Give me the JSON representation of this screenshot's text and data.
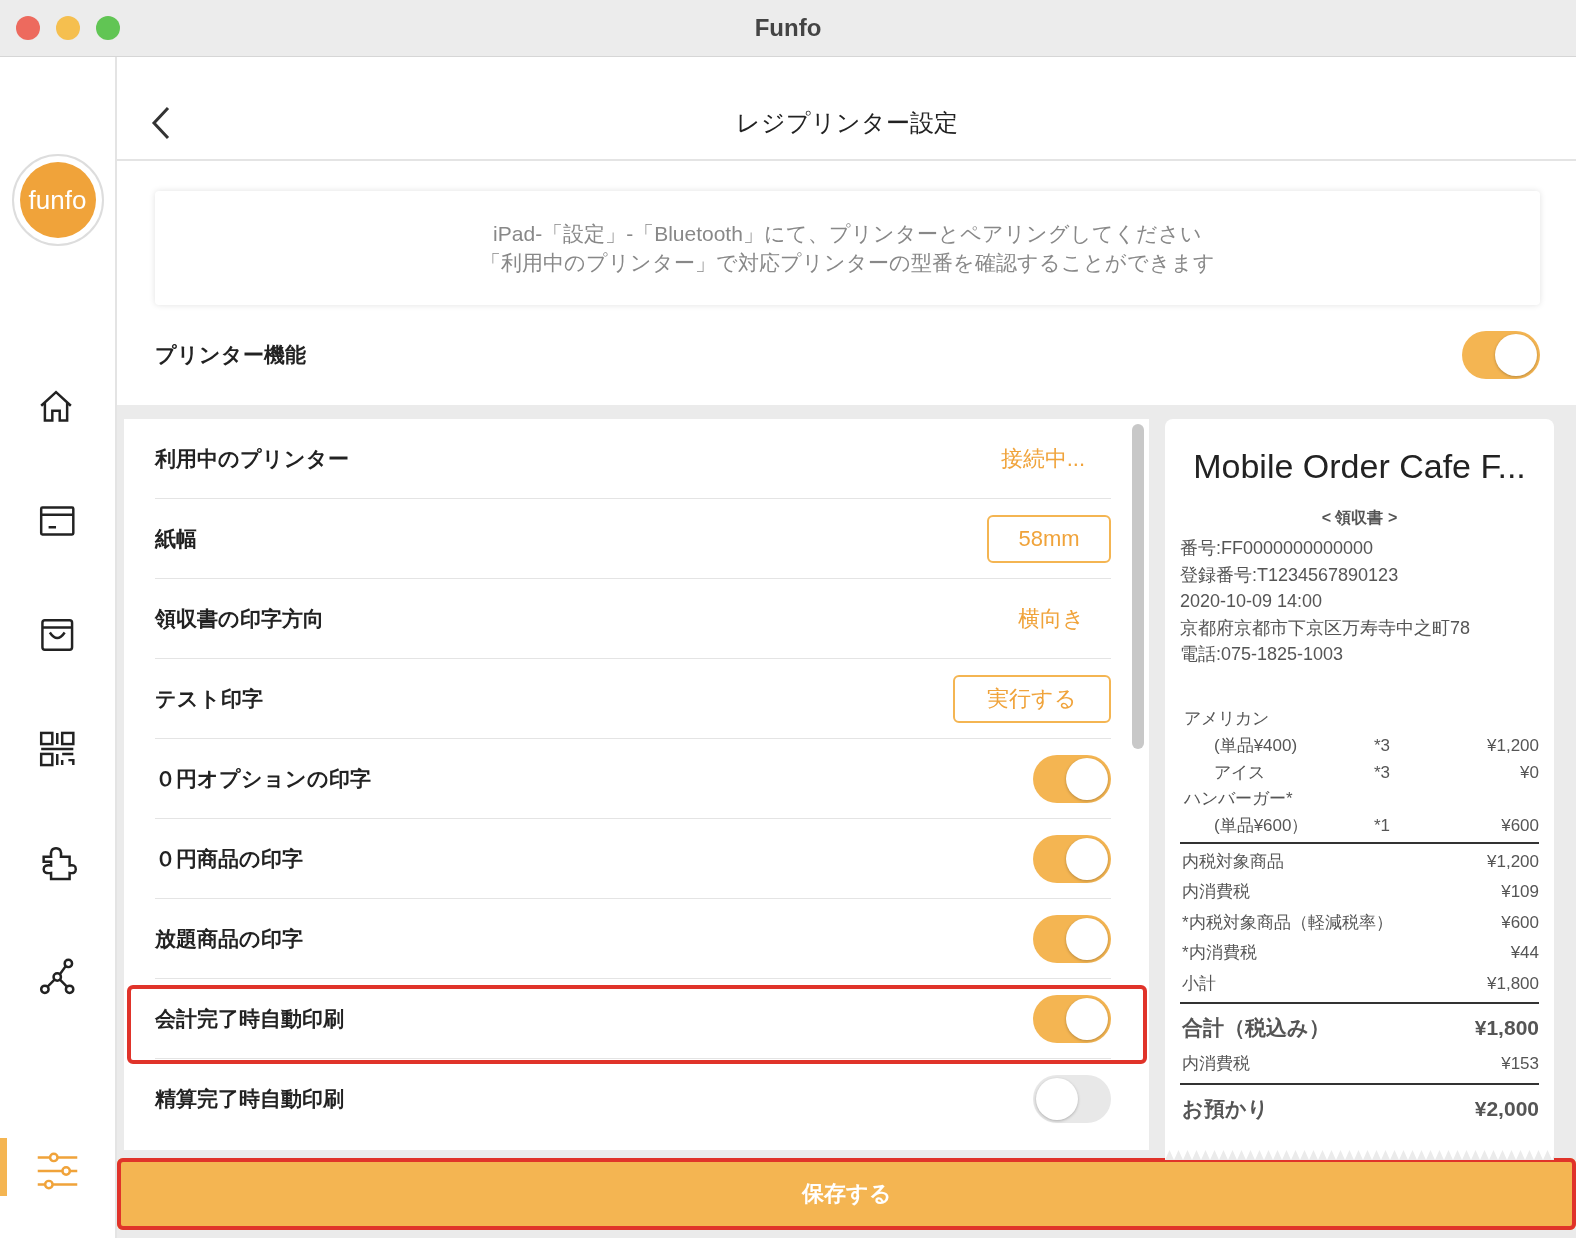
{
  "window": {
    "title": "Funfo"
  },
  "sidebar": {
    "logo": "funfo",
    "items": [
      {
        "selected": false
      },
      {
        "selected": false
      },
      {
        "selected": false
      },
      {
        "selected": false
      },
      {
        "selected": false
      },
      {
        "selected": false
      },
      {
        "selected": true
      }
    ]
  },
  "header": {
    "title": "レジプリンター設定"
  },
  "info": [
    "iPad-「設定」-「Bluetooth」にて、プリンターとペアリングしてください",
    "「利用中のプリンター」で対応プリンターの型番を確認することができます"
  ],
  "printer_function": {
    "label": "プリンター機能",
    "on": true
  },
  "settings": [
    {
      "kind": "status",
      "label": "利用中のプリンター",
      "value": "接続中...",
      "highlighted": false
    },
    {
      "kind": "select",
      "label": "紙幅",
      "value": "58mm",
      "highlighted": false
    },
    {
      "kind": "value",
      "label": "領収書の印字方向",
      "value": "横向き",
      "highlighted": false
    },
    {
      "kind": "action",
      "label": "テスト印字",
      "value": "実行する",
      "highlighted": false
    },
    {
      "kind": "toggle",
      "label": "０円オプションの印字",
      "on": true,
      "highlighted": false
    },
    {
      "kind": "toggle",
      "label": "０円商品の印字",
      "on": true,
      "highlighted": false
    },
    {
      "kind": "toggle",
      "label": "放題商品の印字",
      "on": true,
      "highlighted": false
    },
    {
      "kind": "toggle",
      "label": "会計完了時自動印刷",
      "on": true,
      "highlighted": true
    },
    {
      "kind": "toggle",
      "label": "精算完了時自動印刷",
      "on": false,
      "highlighted": false
    }
  ],
  "receipt": {
    "store": "Mobile Order Cafe F...",
    "heading": "< 領収書 >",
    "info": [
      "番号:FF0000000000000",
      "登録番号:T1234567890123",
      "2020-10-09 14:00",
      "京都府京都市下京区万寿寺中之町78",
      "電話:075-1825-1003"
    ],
    "lines": [
      {
        "kind": "item",
        "name": "アメリカン"
      },
      {
        "kind": "sub",
        "name": "(単品¥400)",
        "qty": "*3",
        "amount": "¥1,200"
      },
      {
        "kind": "sub",
        "name": "アイス",
        "qty": "*3",
        "amount": "¥0"
      },
      {
        "kind": "item",
        "name": "ハンバーガー*"
      },
      {
        "kind": "sub",
        "name": "(単品¥600）",
        "qty": "*1",
        "amount": "¥600"
      },
      {
        "kind": "rule"
      },
      {
        "kind": "total",
        "name": "内税対象商品",
        "amount": "¥1,200"
      },
      {
        "kind": "total",
        "name": "内消費税",
        "amount": "¥109"
      },
      {
        "kind": "total",
        "name": "*内税対象商品（軽減税率）",
        "amount": "¥600"
      },
      {
        "kind": "total",
        "name": "*内消費税",
        "amount": "¥44"
      },
      {
        "kind": "total",
        "name": "小計",
        "amount": "¥1,800"
      },
      {
        "kind": "rule"
      },
      {
        "kind": "grand",
        "name": "合計（税込み）",
        "amount": "¥1,800"
      },
      {
        "kind": "total",
        "name": "内消費税",
        "amount": "¥153"
      },
      {
        "kind": "rule"
      },
      {
        "kind": "grand",
        "name": "お預かり",
        "amount": "¥2,000"
      }
    ]
  },
  "save": {
    "label": "保存する",
    "highlighted": true
  }
}
